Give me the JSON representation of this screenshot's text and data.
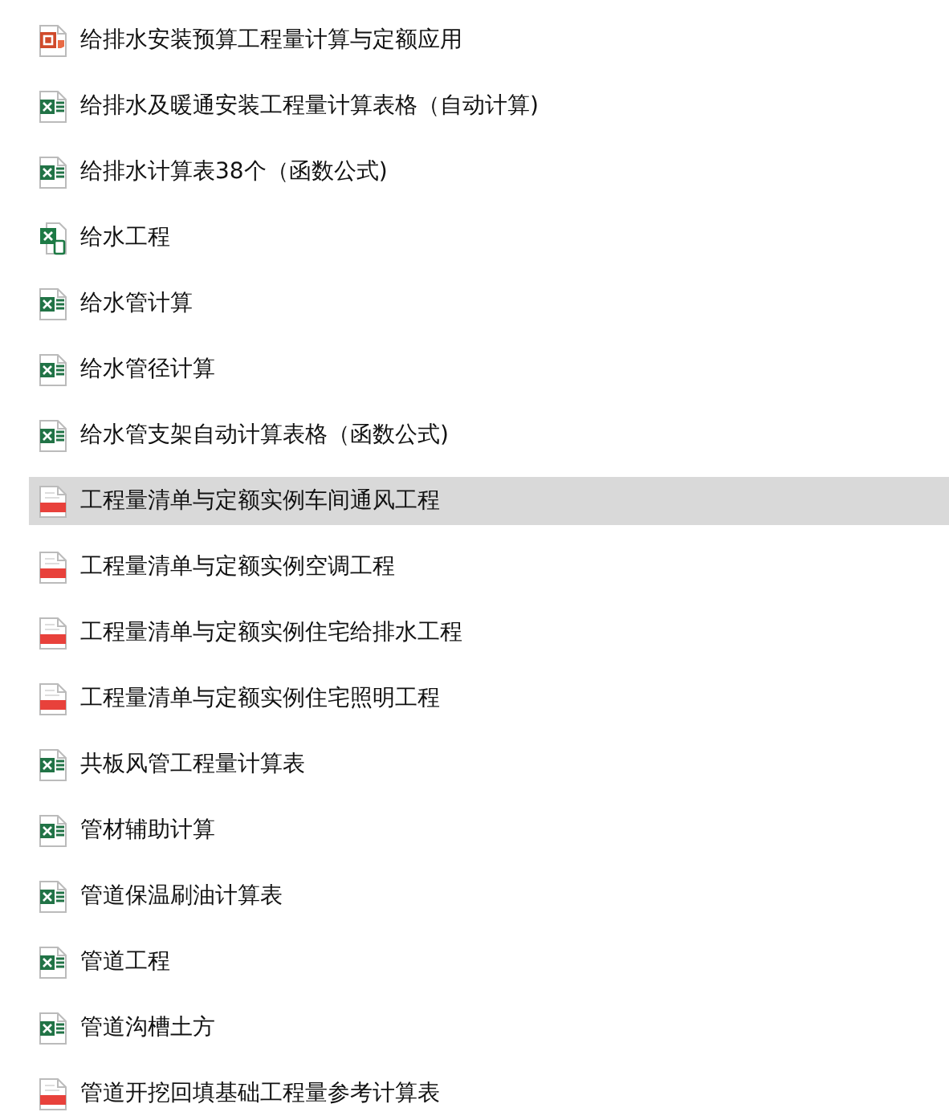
{
  "files": [
    {
      "kind": "ppt",
      "name": "给排水安装预算工程量计算与定额应用",
      "selected": false
    },
    {
      "kind": "xls",
      "name": "给排水及暖通安装工程量计算表格（自动计算)",
      "selected": false
    },
    {
      "kind": "xls",
      "name": "给排水计算表38个（函数公式)",
      "selected": false
    },
    {
      "kind": "xlsx",
      "name": "给水工程",
      "selected": false
    },
    {
      "kind": "xls",
      "name": "给水管计算",
      "selected": false
    },
    {
      "kind": "xls",
      "name": "给水管径计算",
      "selected": false
    },
    {
      "kind": "xls",
      "name": "给水管支架自动计算表格（函数公式)",
      "selected": false
    },
    {
      "kind": "pdf",
      "name": "工程量清单与定额实例车间通风工程",
      "selected": true
    },
    {
      "kind": "pdf",
      "name": "工程量清单与定额实例空调工程",
      "selected": false
    },
    {
      "kind": "pdf",
      "name": "工程量清单与定额实例住宅给排水工程",
      "selected": false
    },
    {
      "kind": "pdf",
      "name": "工程量清单与定额实例住宅照明工程",
      "selected": false
    },
    {
      "kind": "xls",
      "name": "共板风管工程量计算表",
      "selected": false
    },
    {
      "kind": "xls",
      "name": "管材辅助计算",
      "selected": false
    },
    {
      "kind": "xls",
      "name": "管道保温刷油计算表",
      "selected": false
    },
    {
      "kind": "xls",
      "name": "管道工程",
      "selected": false
    },
    {
      "kind": "xls",
      "name": "管道沟槽土方",
      "selected": false
    },
    {
      "kind": "pdf",
      "name": "管道开挖回填基础工程量参考计算表",
      "selected": false
    }
  ]
}
